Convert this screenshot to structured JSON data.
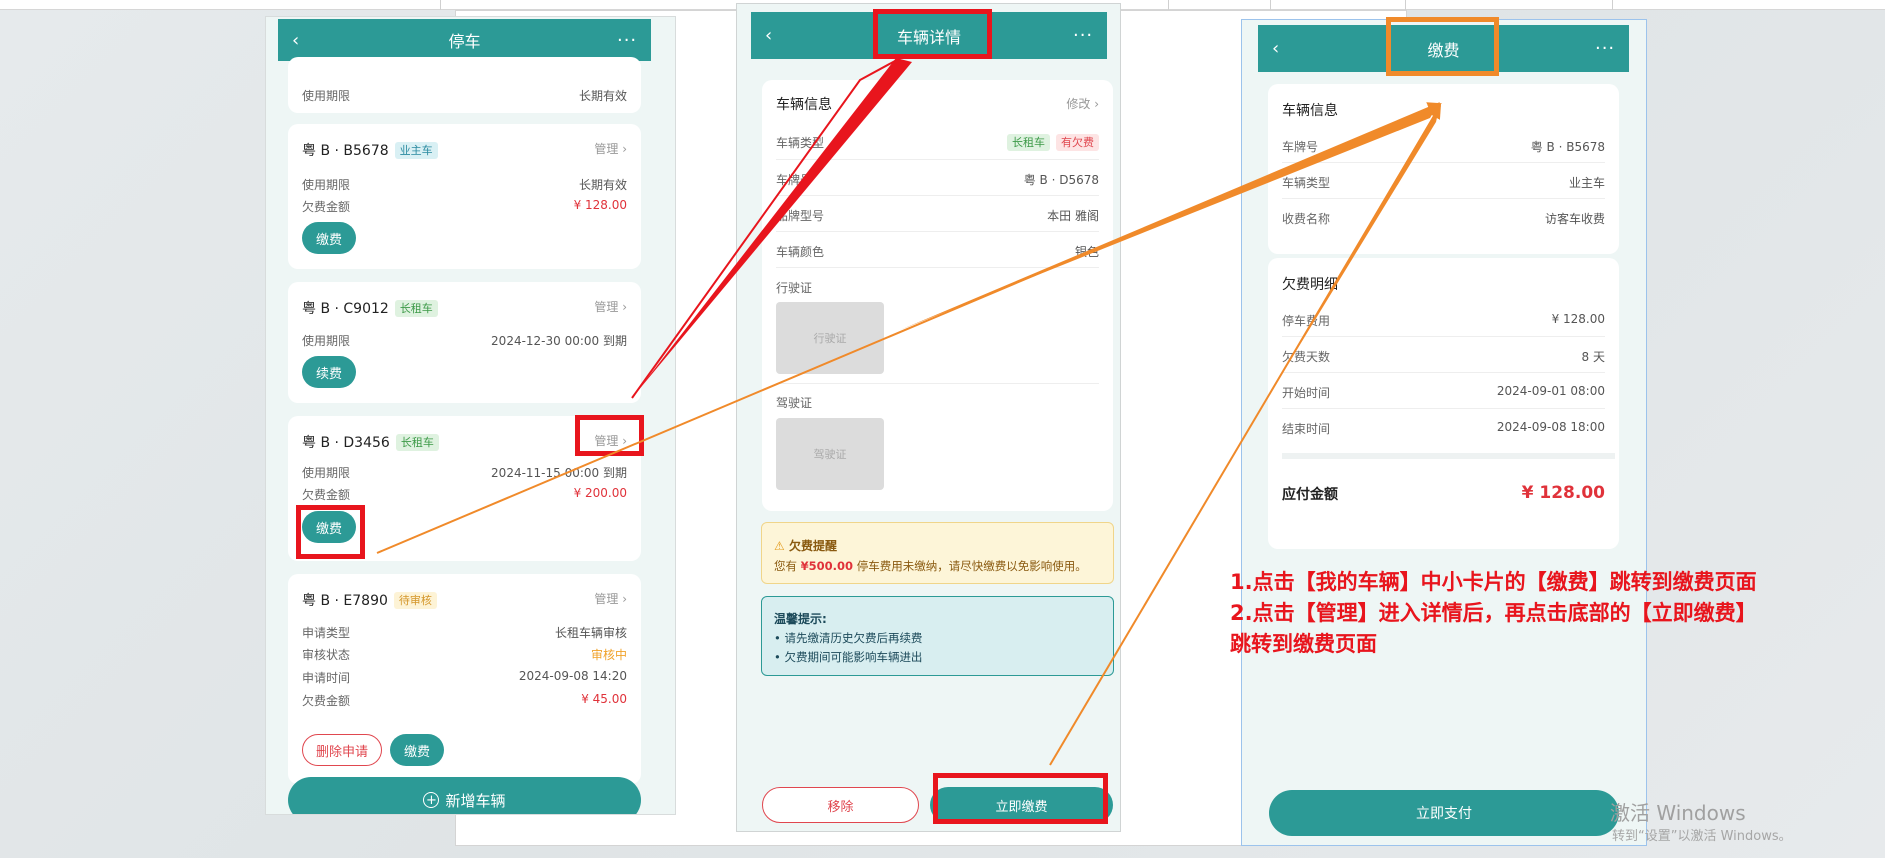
{
  "common": {
    "back": "‹",
    "more": "···",
    "chevron": "›"
  },
  "phone1": {
    "title": "停车",
    "card0": {
      "label": "使用期限",
      "value": "长期有效"
    },
    "card1": {
      "plate": "粤 B · B5678",
      "tag": "业主车",
      "manage": "管理",
      "rows": [
        {
          "label": "使用期限",
          "value": "长期有效"
        },
        {
          "label": "欠费金额",
          "value": "¥ 128.00"
        }
      ],
      "button": "缴费"
    },
    "card2": {
      "plate": "粤 B · C9012",
      "tag": "长租车",
      "manage": "管理",
      "rows": [
        {
          "label": "使用期限",
          "value": "2024-12-30 00:00 到期"
        }
      ],
      "button": "续费"
    },
    "card3": {
      "plate": "粤 B · D3456",
      "tag": "长租车",
      "manage": "管理",
      "rows": [
        {
          "label": "使用期限",
          "value": "2024-11-15 00:00 到期"
        },
        {
          "label": "欠费金额",
          "value": "¥ 200.00"
        }
      ],
      "button": "缴费"
    },
    "card4": {
      "plate": "粤 B · E7890",
      "tag": "待审核",
      "manage": "管理",
      "rows": [
        {
          "label": "申请类型",
          "value": "长租车辆审核"
        },
        {
          "label": "审核状态",
          "value": "审核中"
        },
        {
          "label": "申请时间",
          "value": "2024-09-08 14:20"
        },
        {
          "label": "欠费金额",
          "value": "¥ 45.00"
        }
      ],
      "delete_button": "删除申请",
      "button": "缴费"
    },
    "add_button": "新增车辆",
    "add_icon": "plus-circle-icon"
  },
  "phone2": {
    "title": "车辆详情",
    "section": "车辆信息",
    "edit": "修改",
    "rows": [
      {
        "label": "车辆类型",
        "tags": [
          "长租车",
          "有欠费"
        ]
      },
      {
        "label": "车牌号",
        "value": "粤 B · D5678"
      },
      {
        "label": "品牌型号",
        "value": "本田 雅阁"
      },
      {
        "label": "车辆颜色",
        "value": "银色"
      }
    ],
    "license_label": "行驶证",
    "license_placeholder": "行驶证",
    "driver_label": "驾驶证",
    "driver_placeholder": "驾驶证",
    "warning": {
      "icon": "warning-icon",
      "icon_glyph": "⚠",
      "title": "欠费提醒",
      "text_prefix": "您有",
      "amount": "¥500.00",
      "text_suffix": "停车费用未缴纳，请尽快缴费以免影响使用。"
    },
    "tips": {
      "title": "温馨提示:",
      "items": [
        "• 请先缴清历史欠费后再续费",
        "• 欠费期间可能影响车辆进出"
      ]
    },
    "remove_button": "移除",
    "pay_now_button": "立即缴费"
  },
  "phone3": {
    "title": "缴费",
    "vehicle_section": "车辆信息",
    "vehicle_rows": [
      {
        "label": "车牌号",
        "value": "粤 B · B5678"
      },
      {
        "label": "车辆类型",
        "value": "业主车"
      },
      {
        "label": "收费名称",
        "value": "访客车收费"
      }
    ],
    "arrears_section": "欠费明细",
    "arrears_rows": [
      {
        "label": "停车费用",
        "value": "¥ 128.00"
      },
      {
        "label": "欠费天数",
        "value": "8 天"
      },
      {
        "label": "开始时间",
        "value": "2024-09-01 08:00"
      },
      {
        "label": "结束时间",
        "value": "2024-09-08 18:00"
      }
    ],
    "total_label": "应付金额",
    "total_value": "¥ 128.00",
    "pay_button": "立即支付"
  },
  "annotation": {
    "line1": "1.点击【我的车辆】中小卡片的【缴费】跳转到缴费页面",
    "line2": "2.点击【管理】进入详情后，再点击底部的【立即缴费】",
    "line3": "跳转到缴费页面"
  },
  "watermark": {
    "line1": "激活 Windows",
    "line2": "转到“设置”以激活 Windows。"
  },
  "colors": {
    "primary": "#2c9a96",
    "red": "#e8151d",
    "orange": "#f08a2a",
    "amount_red": "#e0323a"
  }
}
